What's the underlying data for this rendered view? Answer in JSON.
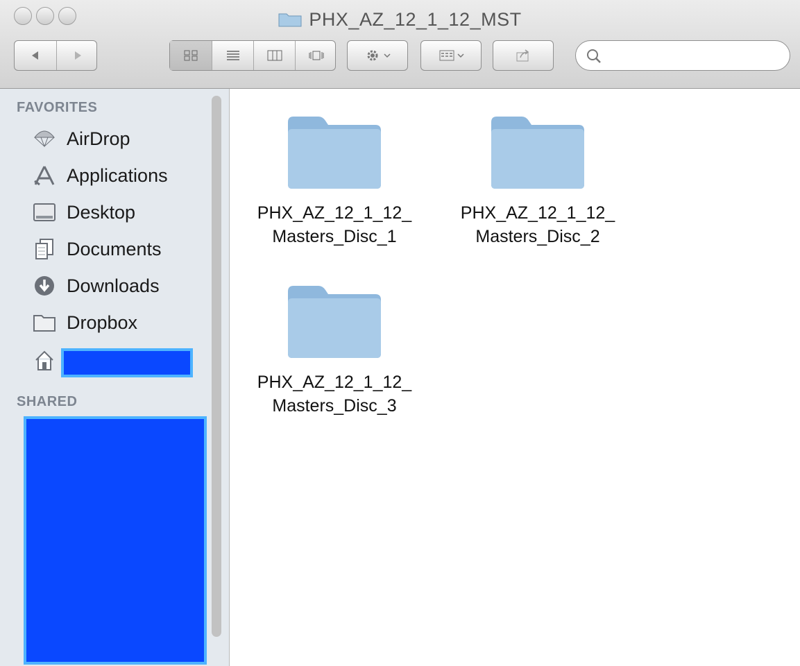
{
  "window": {
    "title": "PHX_AZ_12_1_12_MST"
  },
  "toolbar": {
    "search_placeholder": ""
  },
  "sidebar": {
    "favorites_heading": "FAVORITES",
    "shared_heading": "SHARED",
    "items": [
      {
        "label": "AirDrop",
        "icon": "airdrop-icon"
      },
      {
        "label": "Applications",
        "icon": "applications-icon"
      },
      {
        "label": "Desktop",
        "icon": "desktop-icon"
      },
      {
        "label": "Documents",
        "icon": "documents-icon"
      },
      {
        "label": "Downloads",
        "icon": "downloads-icon"
      },
      {
        "label": "Dropbox",
        "icon": "folder-icon"
      }
    ]
  },
  "content": {
    "folders": [
      {
        "line1": "PHX_AZ_12_1_12_",
        "line2": "Masters_Disc_1"
      },
      {
        "line1": "PHX_AZ_12_1_12_",
        "line2": "Masters_Disc_2"
      },
      {
        "line1": "PHX_AZ_12_1_12_",
        "line2": "Masters_Disc_3"
      }
    ]
  },
  "colors": {
    "redaction": "#0a48ff",
    "redaction_border": "#4db3ff",
    "sidebar_bg": "#e4e9ee",
    "folder_blue": "#9cc4e4"
  }
}
